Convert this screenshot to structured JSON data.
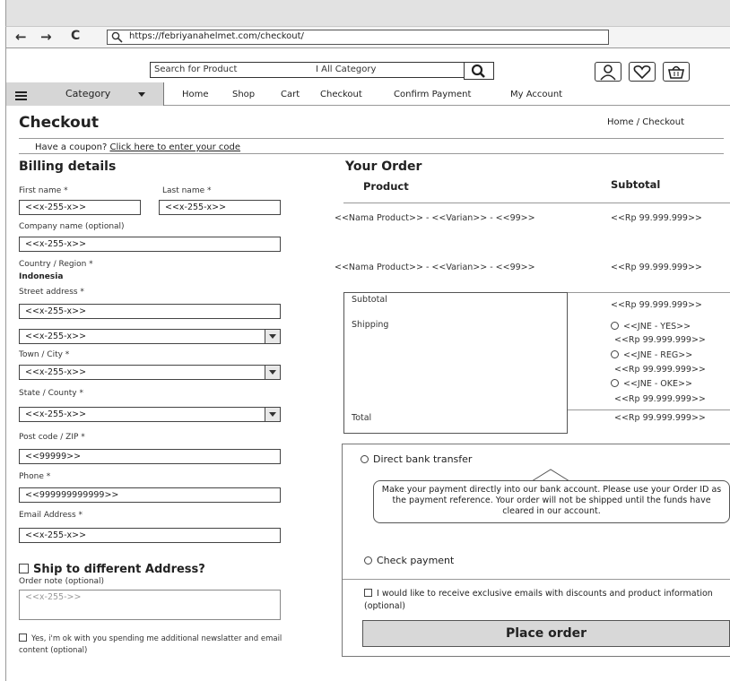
{
  "browser": {
    "url": "https://febriyanahelmet.com/checkout/",
    "back_glyph": "←",
    "forward_glyph": "→",
    "reload_glyph": "C"
  },
  "header": {
    "search_placeholder": "Search for Product",
    "category_select": "I All Category",
    "icons": [
      "search-icon",
      "user-icon",
      "heart-icon",
      "basket-icon"
    ]
  },
  "nav": {
    "category_label": "Category",
    "items": [
      "Home",
      "Shop",
      "Cart",
      "Checkout",
      "Confirm Payment",
      "My Account"
    ]
  },
  "page": {
    "title": "Checkout",
    "breadcrumb": "Home / Checkout"
  },
  "coupon": {
    "prompt": "Have a coupon?",
    "link": "Click here to enter your code"
  },
  "billing": {
    "heading": "Billing details",
    "first_name_label": "First name *",
    "first_name_value": "<<x-255-x>>",
    "last_name_label": "Last name *",
    "last_name_value": "<<x-255-x>>",
    "company_label": "Company name (optional)",
    "company_value": "<<x-255-x>>",
    "country_label": "Country / Region *",
    "country_value": "Indonesia",
    "street_label": "Street address *",
    "street_value_1": "<<x-255-x>>",
    "street_value_2": "<<x-255-x>>",
    "town_label": "Town / City *",
    "town_value": "<<x-255-x>>",
    "state_label": "State / County *",
    "state_value": "<<x-255-x>>",
    "postcode_label": "Post code / ZIP *",
    "postcode_value": "<<99999>>",
    "phone_label": "Phone *",
    "phone_value": "<<999999999999>>",
    "email_label": "Email Address *",
    "email_value": "<<x-255-x>>",
    "ship_different": "Ship to different Address?",
    "order_note_label": "Order note (optional)",
    "order_note_placeholder": "<<x-255->>",
    "newsletter_consent": "Yes, i'm ok with you spending me additional newslatter and email content (optional)"
  },
  "order": {
    "heading": "Your Order",
    "col_product": "Product",
    "col_subtotal": "Subtotal",
    "lines": [
      {
        "product": "<<Nama Product>> - <<Varian>> - <<99>>",
        "subtotal": "<<Rp 99.999.999>>"
      },
      {
        "product": "<<Nama Product>> - <<Varian>> - <<99>>",
        "subtotal": "<<Rp 99.999.999>>"
      }
    ],
    "subtotal_label": "Subtotal",
    "subtotal_value": "<<Rp 99.999.999>>",
    "shipping_label": "Shipping",
    "shipping_options": [
      {
        "name": "<<JNE - YES>>",
        "price": "<<Rp 99.999.999>>"
      },
      {
        "name": "<<JNE - REG>>",
        "price": "<<Rp 99.999.999>>"
      },
      {
        "name": "<<JNE - OKE>>",
        "price": "<<Rp 99.999.999>>"
      }
    ],
    "total_label": "Total",
    "total_value": "<<Rp 99.999.999>>"
  },
  "payment": {
    "direct_bank": "Direct bank transfer",
    "bank_note": "Make your payment directly into our bank account. Please use your Order ID as the payment reference. Your order will not be shipped until the funds have cleared in our account.",
    "check_payment": "Check payment",
    "promo_consent": "I would like to receive exclusive emails with discounts and product information (optional)",
    "place_order": "Place order"
  }
}
